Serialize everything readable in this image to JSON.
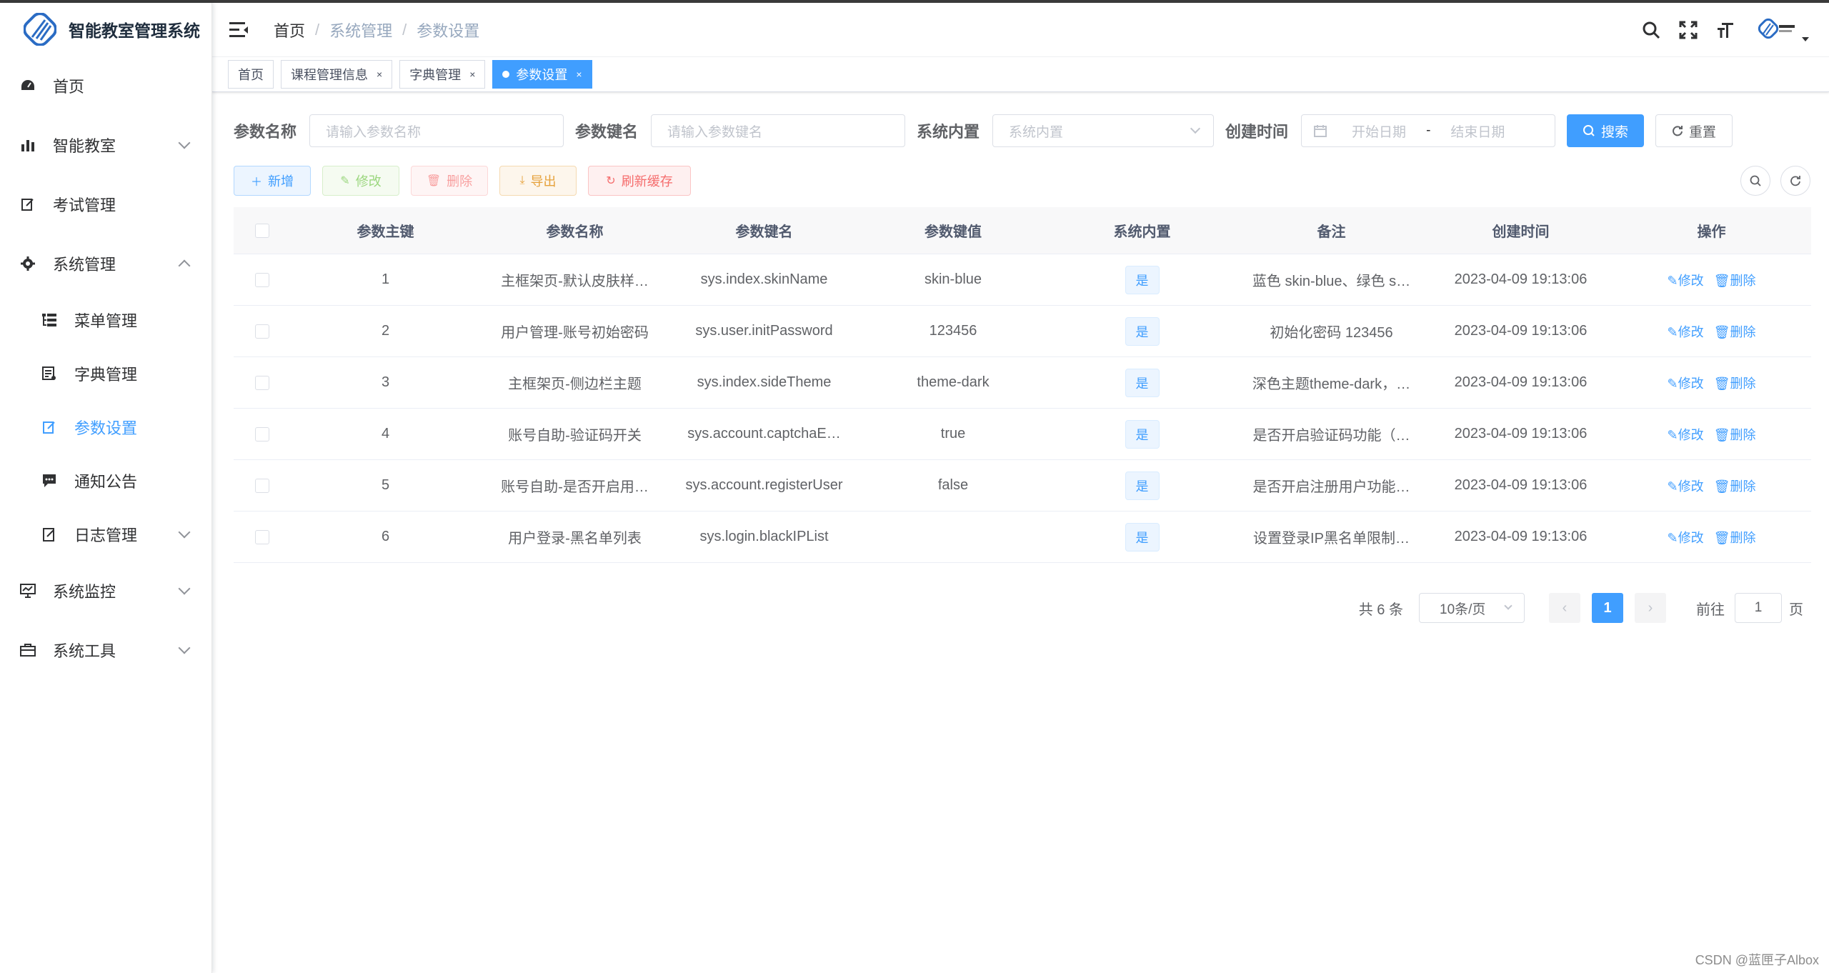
{
  "app": {
    "title": "智能教室管理系统"
  },
  "sidebar": {
    "items": [
      {
        "label": "首页",
        "icon": "dashboard-icon"
      },
      {
        "label": "智能教室",
        "icon": "bar-chart-icon"
      },
      {
        "label": "考试管理",
        "icon": "edit-icon"
      },
      {
        "label": "系统管理",
        "icon": "gear-icon"
      },
      {
        "label": "系统监控",
        "icon": "monitor-icon"
      },
      {
        "label": "系统工具",
        "icon": "toolbox-icon"
      }
    ],
    "subitems": [
      {
        "label": "菜单管理",
        "icon": "tree-table-icon"
      },
      {
        "label": "字典管理",
        "icon": "dict-icon"
      },
      {
        "label": "参数设置",
        "icon": "edit-icon"
      },
      {
        "label": "通知公告",
        "icon": "message-icon"
      },
      {
        "label": "日志管理",
        "icon": "log-icon"
      }
    ]
  },
  "breadcrumb": [
    "首页",
    "系统管理",
    "参数设置"
  ],
  "tags": [
    {
      "label": "首页"
    },
    {
      "label": "课程管理信息"
    },
    {
      "label": "字典管理"
    },
    {
      "label": "参数设置"
    }
  ],
  "search": {
    "config_name_label": "参数名称",
    "config_name_placeholder": "请输入参数名称",
    "config_key_label": "参数键名",
    "config_key_placeholder": "请输入参数键名",
    "config_type_label": "系统内置",
    "config_type_placeholder": "系统内置",
    "create_time_label": "创建时间",
    "start_placeholder": "开始日期",
    "range_separator": "-",
    "end_placeholder": "结束日期",
    "search_button": "搜索",
    "reset_button": "重置"
  },
  "toolbar": {
    "add": "新增",
    "edit": "修改",
    "delete": "删除",
    "export": "导出",
    "refresh_cache": "刷新缓存"
  },
  "table": {
    "headers": [
      "参数主键",
      "参数名称",
      "参数键名",
      "参数键值",
      "系统内置",
      "备注",
      "创建时间",
      "操作"
    ],
    "rows": [
      {
        "id": "1",
        "name": "主框架页-默认皮肤样…",
        "key": "sys.index.skinName",
        "value": "skin-blue",
        "type": "是",
        "remark": "蓝色 skin-blue、绿色 s…",
        "time": "2023-04-09 19:13:06"
      },
      {
        "id": "2",
        "name": "用户管理-账号初始密码",
        "key": "sys.user.initPassword",
        "value": "123456",
        "type": "是",
        "remark": "初始化密码 123456",
        "time": "2023-04-09 19:13:06"
      },
      {
        "id": "3",
        "name": "主框架页-侧边栏主题",
        "key": "sys.index.sideTheme",
        "value": "theme-dark",
        "type": "是",
        "remark": "深色主题theme-dark，…",
        "time": "2023-04-09 19:13:06"
      },
      {
        "id": "4",
        "name": "账号自助-验证码开关",
        "key": "sys.account.captchaE…",
        "value": "true",
        "type": "是",
        "remark": "是否开启验证码功能（…",
        "time": "2023-04-09 19:13:06"
      },
      {
        "id": "5",
        "name": "账号自助-是否开启用…",
        "key": "sys.account.registerUser",
        "value": "false",
        "type": "是",
        "remark": "是否开启注册用户功能…",
        "time": "2023-04-09 19:13:06"
      },
      {
        "id": "6",
        "name": "用户登录-黑名单列表",
        "key": "sys.login.blackIPList",
        "value": "",
        "type": "是",
        "remark": "设置登录IP黑名单限制…",
        "time": "2023-04-09 19:13:06"
      }
    ],
    "op_edit": "修改",
    "op_delete": "删除"
  },
  "pagination": {
    "total_text": "共 6 条",
    "page_size": "10条/页",
    "prev": "‹",
    "current": "1",
    "next": "›",
    "goto_label": "前往",
    "goto_value": "1",
    "page_unit": "页"
  },
  "watermark": "CSDN @蓝匣子Albox",
  "colors": {
    "primary": "#409eff",
    "success": "#67c23a",
    "danger": "#f56c6c",
    "warning": "#e6a23c"
  }
}
